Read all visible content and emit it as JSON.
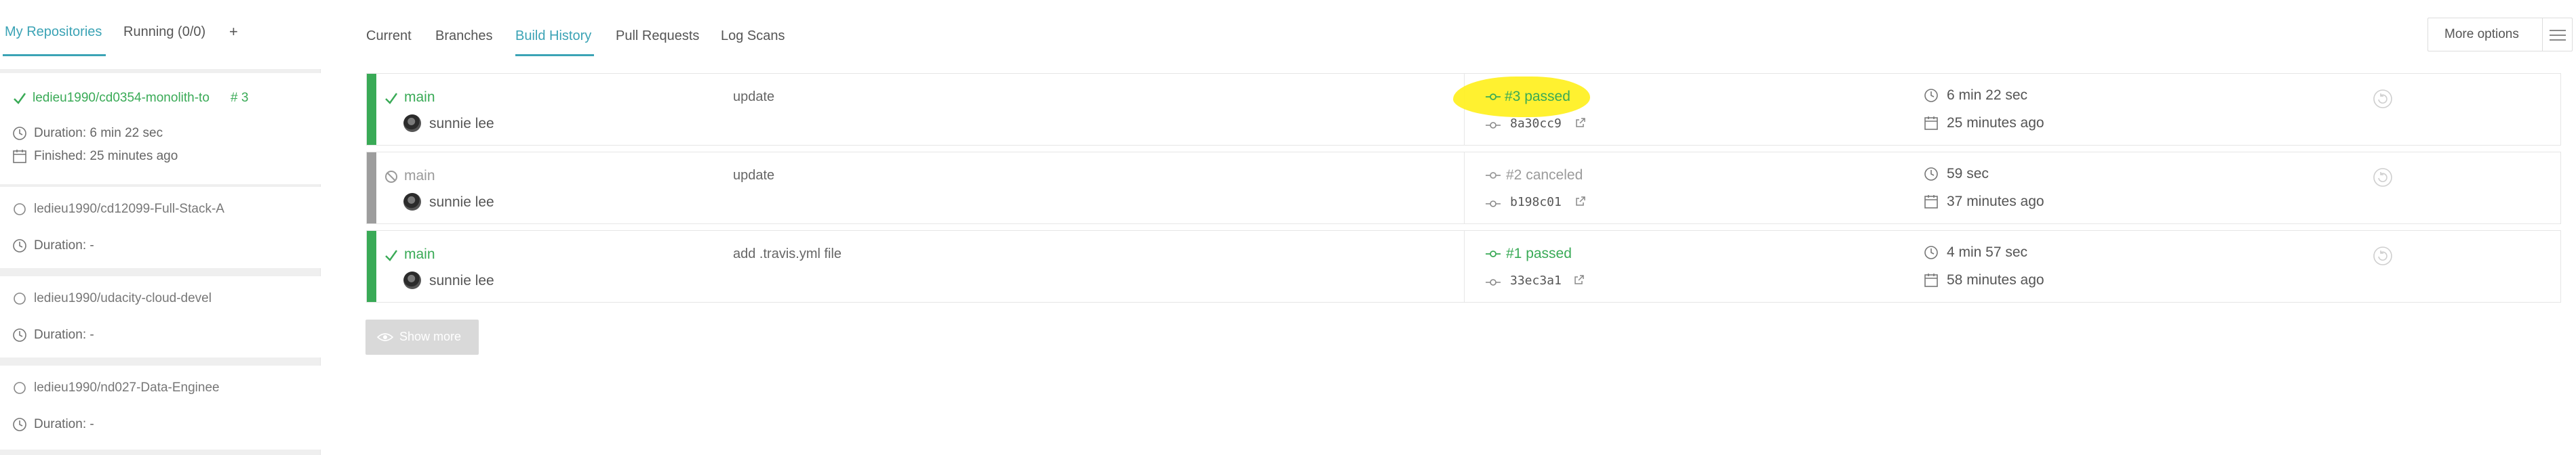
{
  "sidebar": {
    "tabs": [
      {
        "label": "My Repositories"
      },
      {
        "label": "Running (0/0)"
      }
    ],
    "add_label": "+",
    "repos": [
      {
        "name": "ledieu1990/cd0354-monolith-to",
        "build_num": "# 3",
        "duration": "Duration: 6 min 22 sec",
        "finished": "Finished: 25 minutes ago",
        "state": "passed"
      },
      {
        "name": "ledieu1990/cd12099-Full-Stack-A",
        "duration": "Duration: -",
        "state": "idle"
      },
      {
        "name": "ledieu1990/udacity-cloud-devel",
        "duration": "Duration: -",
        "state": "idle"
      },
      {
        "name": "ledieu1990/nd027-Data-Enginee",
        "duration": "Duration: -",
        "state": "idle"
      }
    ]
  },
  "main": {
    "tabs": [
      {
        "label": "Current"
      },
      {
        "label": "Branches"
      },
      {
        "label": "Build History"
      },
      {
        "label": "Pull Requests"
      },
      {
        "label": "Log Scans"
      }
    ],
    "active_tab": "Build History",
    "more_options_label": "More options",
    "builds": [
      {
        "branch": "main",
        "author": "sunnie lee",
        "message": "update",
        "state": "#3 passed",
        "status": "passed",
        "sha": "8a30cc9",
        "duration": "6 min 22 sec",
        "finished": "25 minutes ago",
        "highlighted": true
      },
      {
        "branch": "main",
        "author": "sunnie lee",
        "message": "update",
        "state": "#2 canceled",
        "status": "canceled",
        "sha": "b198c01",
        "duration": "59 sec",
        "finished": "37 minutes ago",
        "highlighted": false
      },
      {
        "branch": "main",
        "author": "sunnie lee",
        "message": "add .travis.yml file",
        "state": "#1 passed",
        "status": "passed",
        "sha": "33ec3a1",
        "duration": "4 min 57 sec",
        "finished": "58 minutes ago",
        "highlighted": false
      }
    ],
    "show_more_label": "Show more"
  },
  "colors": {
    "passed": "#39aa56",
    "canceled": "#9d9d9d",
    "accent": "#3ba3b5",
    "highlight": "#fff01e"
  }
}
